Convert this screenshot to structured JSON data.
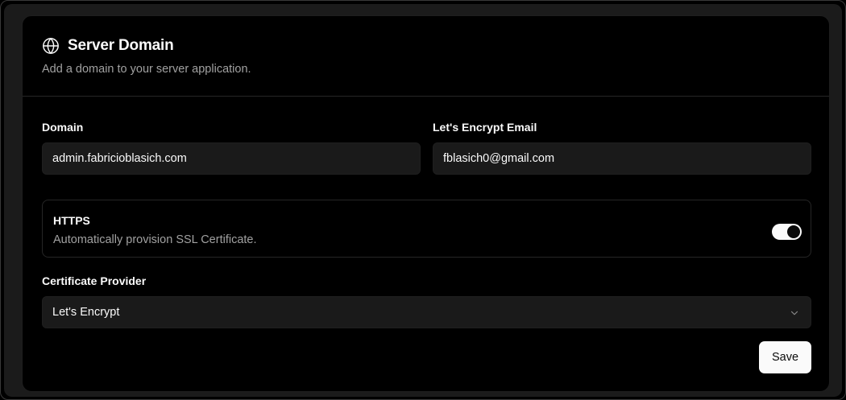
{
  "card": {
    "title": "Server Domain",
    "subtitle": "Add a domain to your server application.",
    "title_icon": "globe-icon"
  },
  "form": {
    "domain": {
      "label": "Domain",
      "value": "admin.fabricioblasich.com"
    },
    "email": {
      "label": "Let's Encrypt Email",
      "value": "fblasich0@gmail.com"
    },
    "https": {
      "title": "HTTPS",
      "description": "Automatically provision SSL Certificate.",
      "enabled": true
    },
    "certificate_provider": {
      "label": "Certificate Provider",
      "selected": "Let's Encrypt",
      "icon": "chevron-down-icon"
    },
    "save_label": "Save"
  },
  "colors": {
    "background": "#000000",
    "surface": "#1a1a1a",
    "border": "#262626",
    "text": "#fafafa",
    "muted_text": "#a1a1a1",
    "button_bg": "#fafafa",
    "button_text": "#0a0a0a"
  }
}
